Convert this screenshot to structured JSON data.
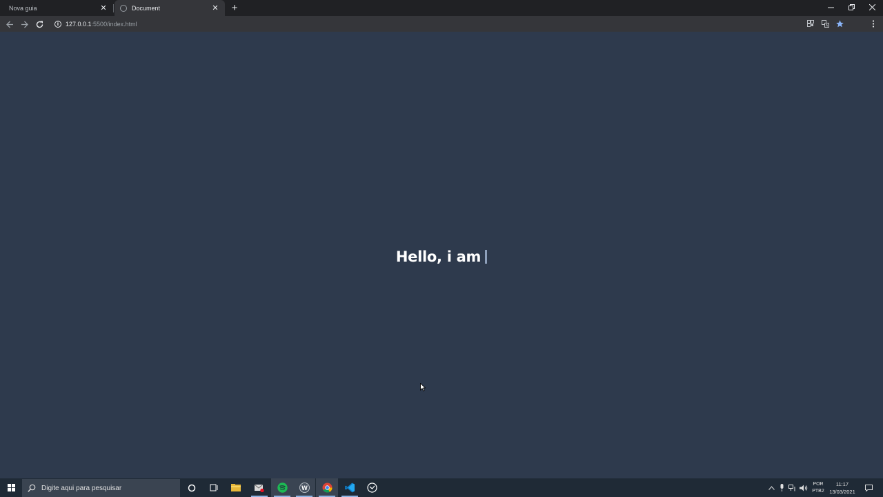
{
  "browser": {
    "tabs": [
      {
        "label": "Nova guia",
        "active": false
      },
      {
        "label": "Document",
        "active": true
      }
    ],
    "url": {
      "host": "127.0.0.1",
      "path": ":5500/index.html"
    },
    "window_controls": {
      "minimize": "–",
      "restore": "❐",
      "close": "✕"
    }
  },
  "page": {
    "headline": "Hello, i am",
    "background": "#2e3a4d",
    "text_color": "#ffffff",
    "cursor_color": "#8ea0bb"
  },
  "taskbar": {
    "search_placeholder": "Digite aqui para pesquisar",
    "apps": [
      "cortana-icon",
      "task-view-icon",
      "file-explorer-icon",
      "mail-icon",
      "spotify-icon",
      "app-w-icon",
      "chrome-icon",
      "vscode-icon",
      "github-desktop-icon"
    ],
    "language": {
      "line1": "POR",
      "line2": "PTB2"
    },
    "clock": {
      "time": "11:17",
      "date": "13/03/2021"
    }
  }
}
